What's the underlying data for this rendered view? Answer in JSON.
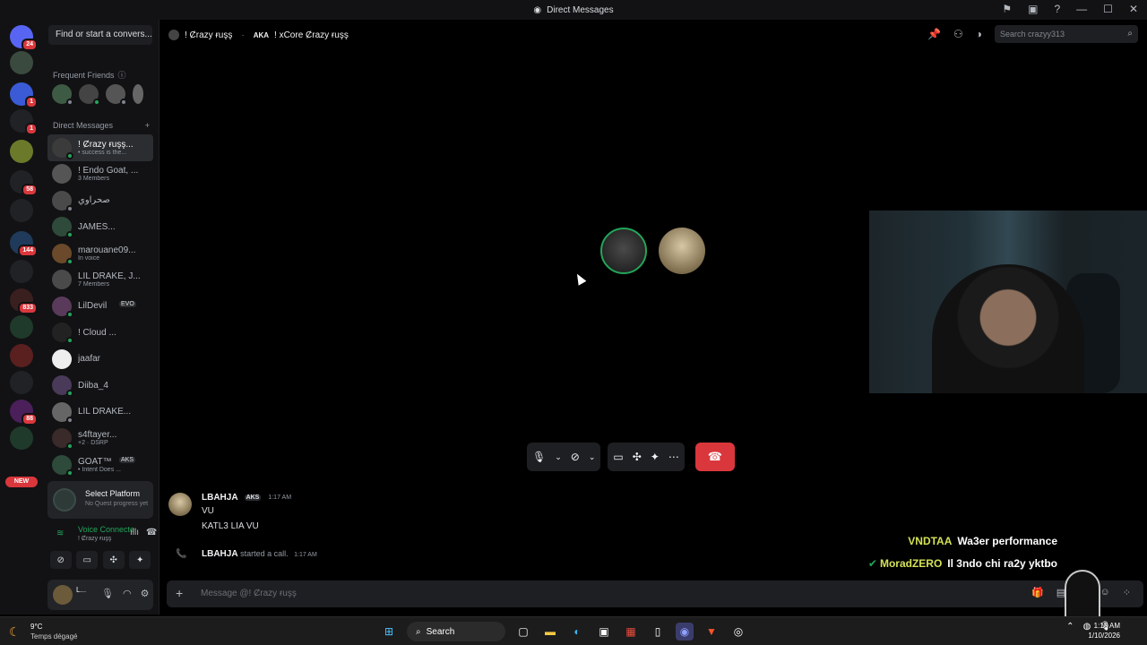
{
  "window": {
    "title": "Direct Messages"
  },
  "server_rail": {
    "servers": [
      {
        "icon": "discord-home-icon",
        "badge": "24",
        "color": "#5865f2"
      },
      {
        "icon": "server-avatar-icon",
        "badge": "",
        "color": "#3a4a3f"
      },
      {
        "icon": "server-layers-icon",
        "badge": "1",
        "color": "#3b5bd6"
      },
      {
        "icon": "server-logo-icon",
        "badge": "1",
        "color": "#202225"
      },
      {
        "icon": "server-avatar-icon",
        "badge": "",
        "color": "#6a7a2a"
      },
      {
        "icon": "server-x-icon",
        "badge": "58",
        "color": "#202225"
      },
      {
        "icon": "server-logo-icon",
        "badge": "",
        "color": "#202225"
      },
      {
        "icon": "server-logo-icon",
        "badge": "144",
        "color": "#1f3a5a"
      },
      {
        "icon": "server-logo-icon",
        "badge": "",
        "color": "#202225"
      },
      {
        "icon": "server-logo-icon",
        "badge": "833",
        "color": "#3a1f1f"
      },
      {
        "icon": "server-logo-icon",
        "badge": "",
        "color": "#1f3a2a"
      },
      {
        "icon": "server-logo-icon",
        "badge": "",
        "color": "#5a1f1f"
      },
      {
        "icon": "server-v-icon",
        "badge": "",
        "color": "#202225"
      },
      {
        "icon": "server-logo-icon",
        "badge": "88",
        "color": "#4a1f5a"
      },
      {
        "icon": "server-logo-icon",
        "badge": "",
        "color": "#1f3a2a"
      }
    ],
    "new_label": "NEW"
  },
  "sidebar": {
    "find_button": "Find or start a convers...",
    "frequent_friends_label": "Frequent Friends",
    "direct_messages_label": "Direct Messages",
    "dms": [
      {
        "name": "! Ȼrazy ɍuşş...",
        "sub": "• success is the...",
        "active": true,
        "status": "online"
      },
      {
        "name": "! Endo Goat, ...",
        "sub": "3 Members",
        "active": false,
        "status": "none"
      },
      {
        "name": "صحراوي",
        "sub": "",
        "active": false,
        "status": "offline"
      },
      {
        "name": "JAMES...",
        "sub": "",
        "active": false,
        "status": "online"
      },
      {
        "name": "marouane09...",
        "sub": "In voice",
        "active": false,
        "status": "online"
      },
      {
        "name": "LIL DRAKE, J...",
        "sub": "7 Members",
        "active": false,
        "status": "none"
      },
      {
        "name": "LilDevil",
        "sub": "",
        "active": false,
        "status": "online",
        "tag": "EVO"
      },
      {
        "name": "! Cloud ...",
        "sub": "",
        "active": false,
        "status": "online"
      },
      {
        "name": "jaafar",
        "sub": "",
        "active": false,
        "status": "none"
      },
      {
        "name": "Diiba_4",
        "sub": "",
        "active": false,
        "status": "online"
      },
      {
        "name": "LIL DRAKE...",
        "sub": "",
        "active": false,
        "status": "offline"
      },
      {
        "name": "s4ftayer...",
        "sub": "+2 · DSRP",
        "active": false,
        "status": "online"
      },
      {
        "name": "GOAT™",
        "sub": "• Intent Does ...",
        "active": false,
        "status": "online",
        "tag": "AKS"
      }
    ],
    "quest": {
      "title": "Select Platform",
      "subtitle": "No Quest progress yet"
    },
    "voice": {
      "status": "Voice Connecte",
      "channel": "! Ȼrazy ɍuşş"
    },
    "user": {
      "name": "L..."
    }
  },
  "header": {
    "name": "! Ȼrazy ɍuşş",
    "aka_label": "AKA",
    "aka_name": "! xCore Ȼrazy ɍuşş",
    "search_placeholder": "Search crazyy313"
  },
  "call_controls": {
    "buttons": [
      "microphone-icon",
      "chevron-down-icon",
      "camera-off-icon",
      "chevron-down-icon",
      "screen-share-icon",
      "activities-icon",
      "soundboard-icon",
      "more-icon"
    ],
    "hangup": "hangup-icon"
  },
  "messages": {
    "author": "LBAHJA",
    "author_tag": "AKS",
    "time": "1:17 AM",
    "lines": [
      "VU",
      "KATL3 LIA VU"
    ],
    "system_author": "LBAHJA",
    "system_text": "started a call.",
    "system_time": "1:17 AM"
  },
  "overlay_chat": [
    {
      "user": "VNDTAA",
      "text": "Wa3er performance",
      "verified": false
    },
    {
      "user": "MoradZERO",
      "text": "Il 3ndo chi ra2y yktbo",
      "verified": true
    }
  ],
  "composer": {
    "placeholder": "Message @! Ȼrazy ɍuşş"
  },
  "taskbar": {
    "weather_temp": "9°C",
    "weather_desc": "Temps dégagé",
    "search_label": "Search",
    "time": "1:18 AM",
    "date": "1/10/2026"
  },
  "colors": {
    "accent": "#5865f2",
    "online": "#23a55a",
    "danger": "#da373c"
  }
}
